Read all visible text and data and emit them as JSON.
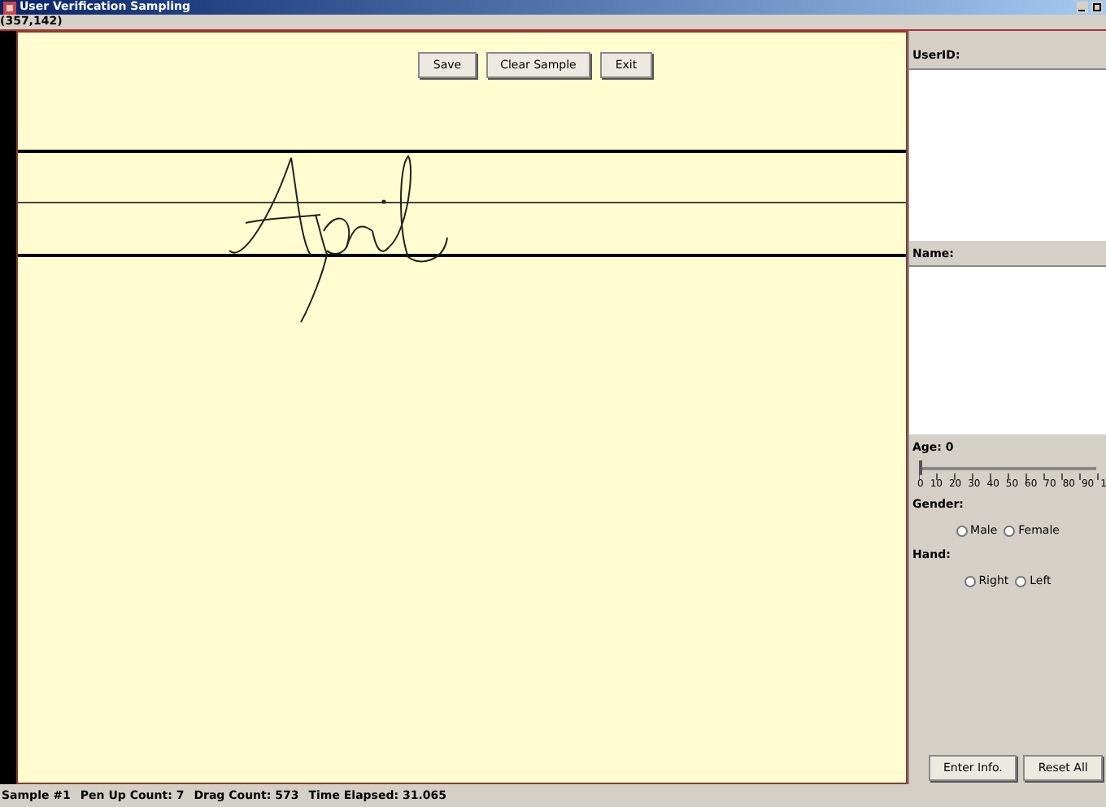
{
  "window": {
    "title": "User Verification Sampling"
  },
  "coordinates": "(357,142)",
  "canvas_buttons": [
    "Save",
    "Clear Sample",
    "Exit"
  ],
  "form": {
    "user_id_label": "UserID:",
    "name_label": "Name:",
    "age_label": "Age: 0",
    "age_slider": {
      "level": 0,
      "tick_labels": [
        "0",
        "10",
        "20",
        "30",
        "40",
        "50",
        "60",
        "70",
        "80",
        "90",
        "1"
      ]
    },
    "gender_label": "Gender:",
    "gender_options": [
      {
        "label": "Male",
        "selected": false
      },
      {
        "label": "Female",
        "selected": false
      }
    ],
    "hand_label": "Hand:",
    "hand_options": [
      {
        "label": "Right",
        "selected": false
      },
      {
        "label": "Left",
        "selected": false
      }
    ],
    "buttons": [
      "Enter Info.",
      "Reset All"
    ]
  },
  "status_bar": [
    "Sample #1",
    "Pen Up Count: 7",
    "Drag Count: 573",
    "Time Elapsed: 31.065"
  ]
}
